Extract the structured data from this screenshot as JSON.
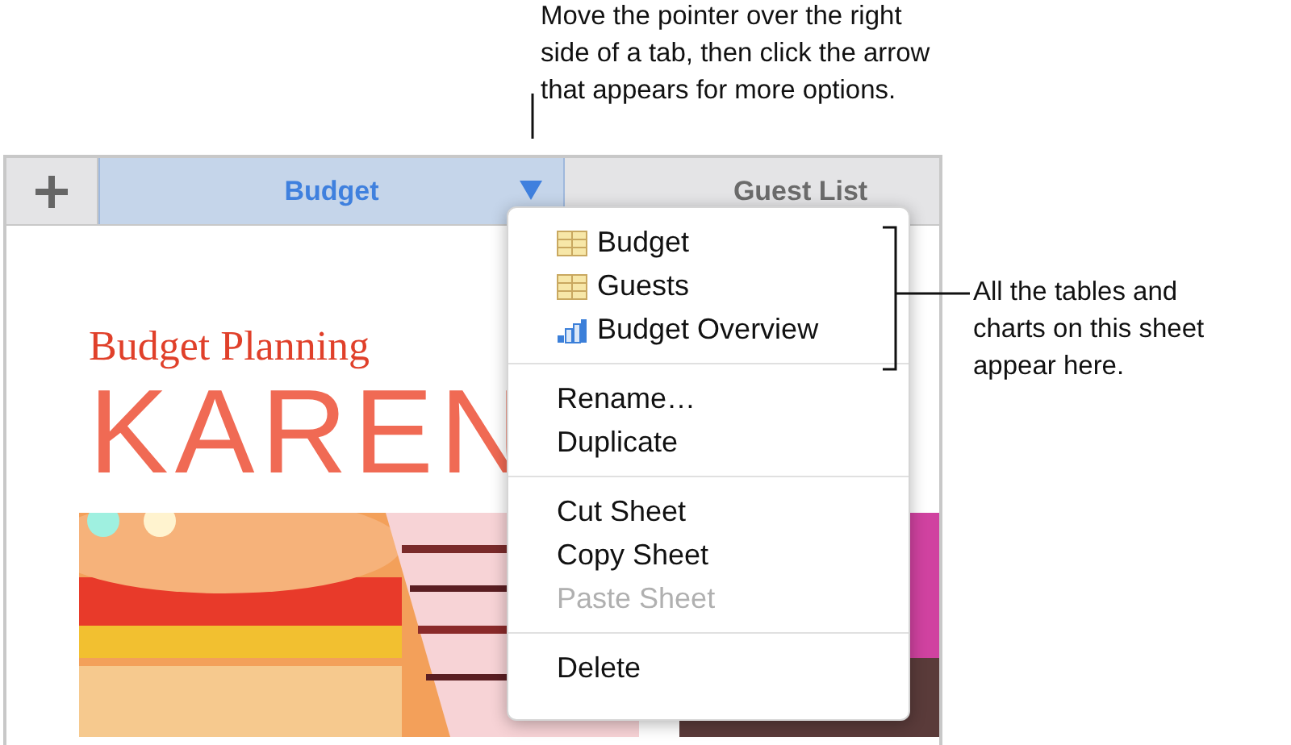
{
  "callout_top": {
    "lines": [
      "Move the pointer over the right",
      "side of a tab, then click the arrow",
      "that appears for more options."
    ]
  },
  "tabs": [
    {
      "label": "Budget",
      "selected": true,
      "arrow": true
    },
    {
      "label": "Guest List",
      "selected": false,
      "arrow": false
    }
  ],
  "document": {
    "heading": "Budget Planning",
    "title": "KAREN"
  },
  "menu": {
    "sections": [
      [
        {
          "label": "Budget",
          "kind": "table",
          "disabled": false
        },
        {
          "label": "Guests",
          "kind": "table",
          "disabled": false
        },
        {
          "label": "Budget Overview",
          "kind": "chart",
          "disabled": false
        }
      ],
      [
        {
          "label": "Rename…",
          "kind": "command",
          "disabled": false
        },
        {
          "label": "Duplicate",
          "kind": "command",
          "disabled": false
        }
      ],
      [
        {
          "label": "Cut Sheet",
          "kind": "command",
          "disabled": false
        },
        {
          "label": "Copy Sheet",
          "kind": "command",
          "disabled": false
        },
        {
          "label": "Paste Sheet",
          "kind": "command",
          "disabled": true
        }
      ],
      [
        {
          "label": "Delete",
          "kind": "command",
          "disabled": false
        }
      ]
    ]
  },
  "callout_side": {
    "lines": [
      "All the tables and",
      "charts on this sheet",
      "appear here."
    ]
  }
}
